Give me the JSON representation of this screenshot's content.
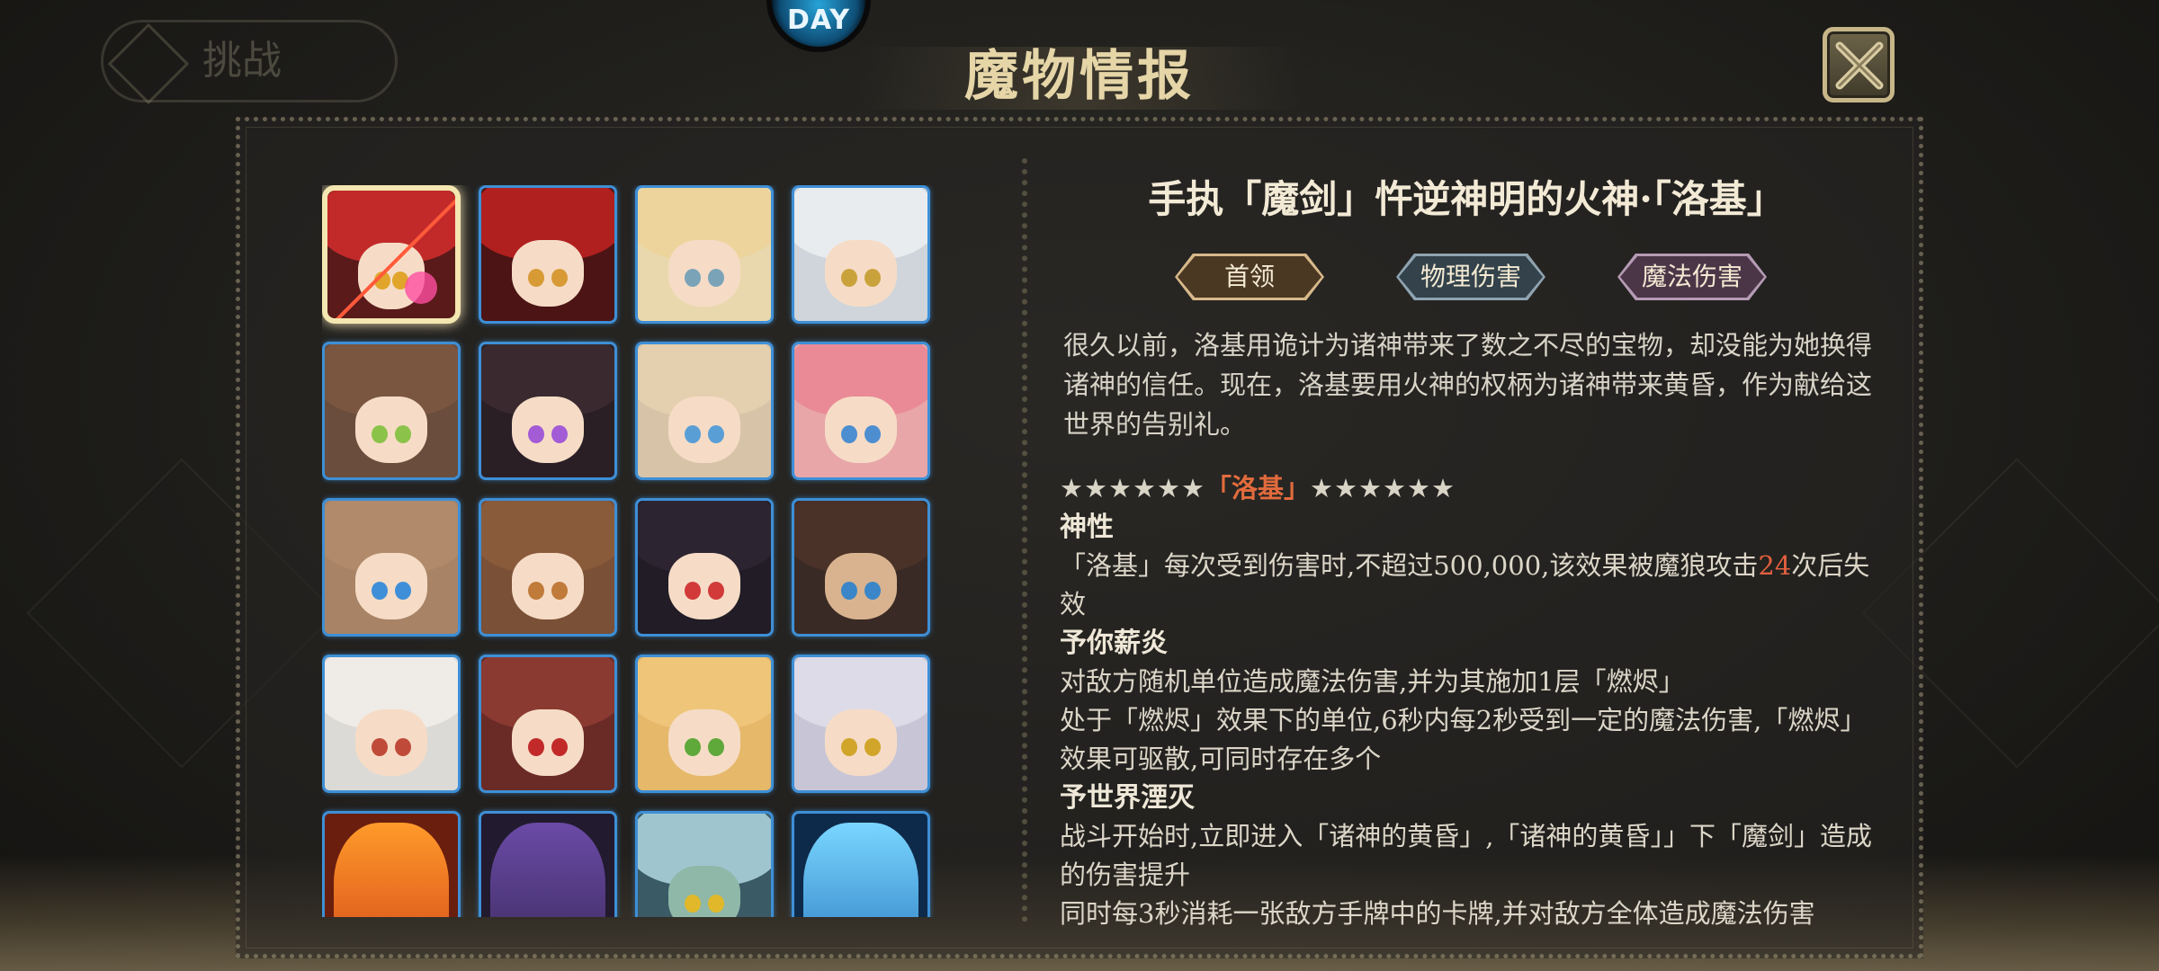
{
  "app": {
    "badge_text": "DAY"
  },
  "background": {
    "back_label": "挑战"
  },
  "header": {
    "title": "魔物情报"
  },
  "monster": {
    "name": "手执「魔剑」忤逆神明的火神·「洛基」",
    "tags": [
      "首领",
      "物理伤害",
      "魔法伤害"
    ],
    "description": "很久以前，洛基用诡计为诸神带来了数之不尽的宝物，却没能为她换得诸神的信任。现在，洛基要用火神的权柄为诸神带来黄昏，作为献给这世界的告别礼。"
  },
  "detail": {
    "stars_left": "★★★★★★",
    "stars_name": "「洛基」",
    "stars_right": "★★★★★★",
    "skill1_title": "神性",
    "skill1_text_a": "「洛基」每次受到伤害时,不超过500,000,该效果被魔狼攻击",
    "skill1_count": "24",
    "skill1_text_b": "次后失效",
    "skill2_title": "予你薪炎",
    "skill2_text_a": "对敌方随机单位造成魔法伤害,并为其施加1层「燃烬」",
    "skill2_text_b": "处于「燃烬」效果下的单位,6秒内每2秒受到一定的魔法伤害,「燃烬」效果可驱散,可同时存在多个",
    "skill3_title": "予世界湮灭",
    "skill3_text_a": "战斗开始时,立即进入「诸神的黄昏」,「诸神的黄昏」」下「魔剑」造成的伤害提升",
    "skill3_text_b": "同时每3秒消耗一张敌方手牌中的卡牌,并对敌方全体造成魔法伤害"
  },
  "colors": {
    "accent_gold": "#e5d5a7",
    "highlight_orange": "#e26b3d",
    "tile_border_blue": "#3e8fd6"
  },
  "icons": {
    "close": "close-x-icon"
  }
}
